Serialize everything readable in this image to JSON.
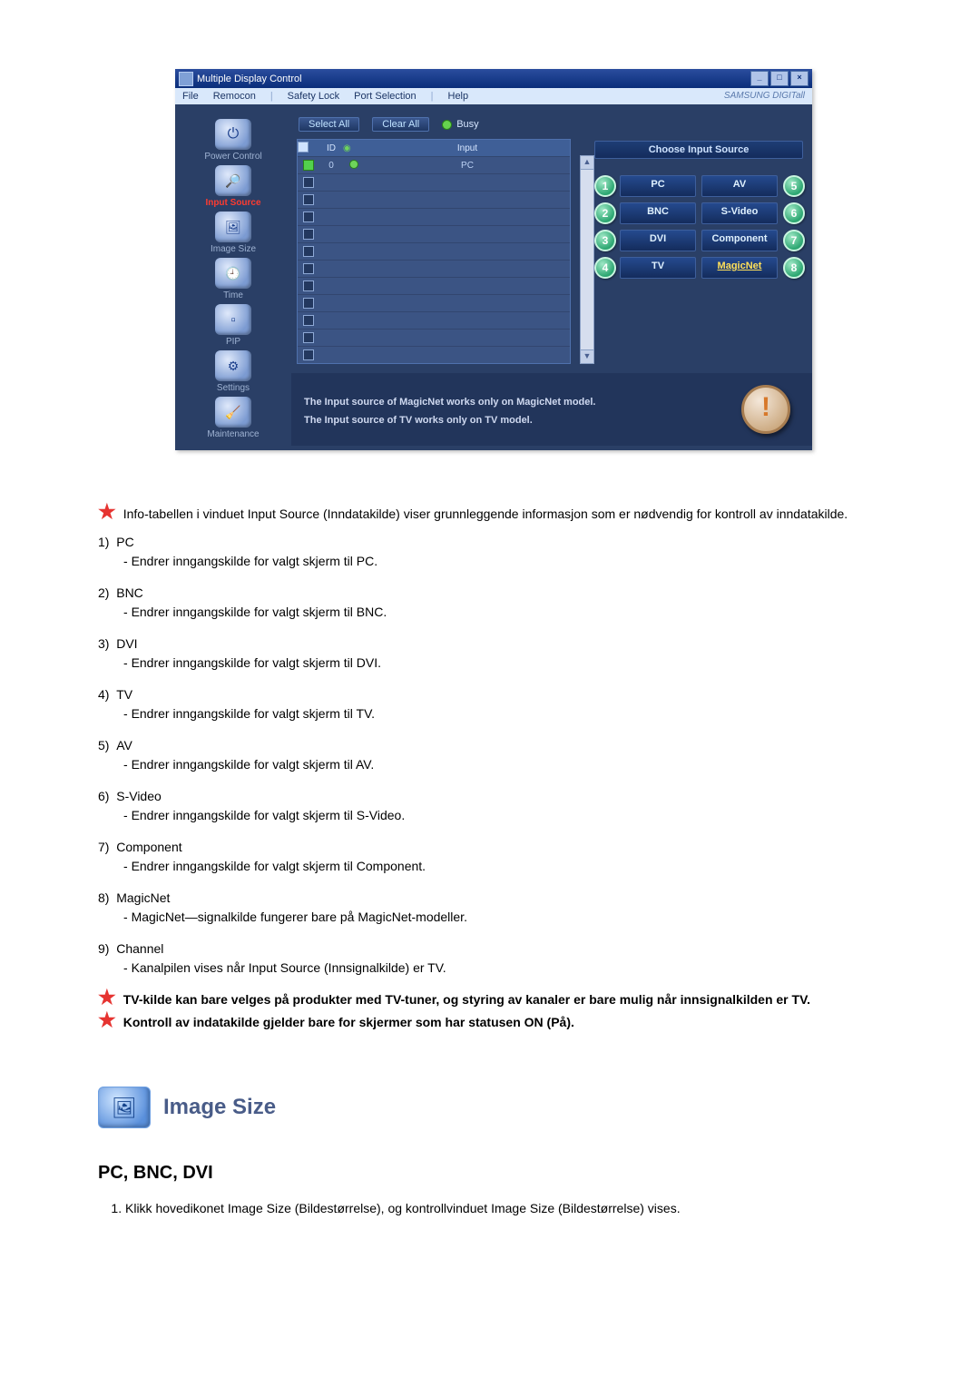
{
  "app": {
    "title": "Multiple Display Control",
    "brand": "SAMSUNG DIGITall"
  },
  "menubar": [
    "File",
    "Remocon",
    "Safety Lock",
    "Port Selection",
    "Help"
  ],
  "toolbar": {
    "select_all": "Select All",
    "clear_all": "Clear All",
    "busy": "Busy"
  },
  "sidebar": [
    {
      "key": "power",
      "label": "Power Control"
    },
    {
      "key": "input-source",
      "label": "Input Source",
      "active": true
    },
    {
      "key": "image-size",
      "label": "Image Size"
    },
    {
      "key": "time",
      "label": "Time"
    },
    {
      "key": "pip",
      "label": "PIP"
    },
    {
      "key": "settings",
      "label": "Settings"
    },
    {
      "key": "maintenance",
      "label": "Maintenance"
    }
  ],
  "grid": {
    "headers": {
      "id": "ID",
      "input": "Input"
    },
    "first_row": {
      "id": "0",
      "input": "PC"
    }
  },
  "choose": {
    "title": "Choose Input Source",
    "items": [
      {
        "n": "1",
        "label": "PC"
      },
      {
        "n": "5",
        "label": "AV"
      },
      {
        "n": "2",
        "label": "BNC"
      },
      {
        "n": "6",
        "label": "S-Video"
      },
      {
        "n": "3",
        "label": "DVI"
      },
      {
        "n": "7",
        "label": "Component"
      },
      {
        "n": "4",
        "label": "TV"
      },
      {
        "n": "8",
        "label": "MagicNet"
      }
    ]
  },
  "footer": {
    "line1": "The Input source of MagicNet works only on MagicNet model.",
    "line2": "The Input source of TV works only on TV  model."
  },
  "doc": {
    "intro": "Info-tabellen i vinduet Input Source (Inndatakilde) viser grunnleggende informasjon som er nødvendig for kontroll av inndatakilde.",
    "items": [
      {
        "n": "1)",
        "head": "PC",
        "desc": "Endrer inngangskilde for valgt skjerm til PC."
      },
      {
        "n": "2)",
        "head": "BNC",
        "desc": "Endrer inngangskilde for valgt skjerm til BNC."
      },
      {
        "n": "3)",
        "head": "DVI",
        "desc": "Endrer inngangskilde for valgt skjerm til DVI."
      },
      {
        "n": "4)",
        "head": "TV",
        "desc": "Endrer inngangskilde for valgt skjerm til TV."
      },
      {
        "n": "5)",
        "head": "AV",
        "desc": "Endrer inngangskilde for valgt skjerm til AV."
      },
      {
        "n": "6)",
        "head": "S-Video",
        "desc": "Endrer inngangskilde for valgt skjerm til S-Video."
      },
      {
        "n": "7)",
        "head": "Component",
        "desc": "Endrer inngangskilde for valgt skjerm til Component."
      },
      {
        "n": "8)",
        "head": "MagicNet",
        "desc": "MagicNet—signalkilde fungerer bare på MagicNet-modeller."
      },
      {
        "n": "9)",
        "head": "Channel",
        "desc": "Kanalpilen vises når Input Source (Innsignalkilde) er TV."
      }
    ],
    "notes": [
      "TV-kilde kan bare velges på produkter med TV-tuner, og styring av kanaler er bare mulig når innsignalkilden er TV.",
      "Kontroll av indatakilde gjelder bare for skjermer som har statusen ON (På)."
    ],
    "section_title": "Image Size",
    "subhead": "PC, BNC, DVI",
    "numstep": "Klikk hovedikonet Image Size (Bildestørrelse), og kontrollvinduet Image Size (Bildestørrelse) vises."
  }
}
